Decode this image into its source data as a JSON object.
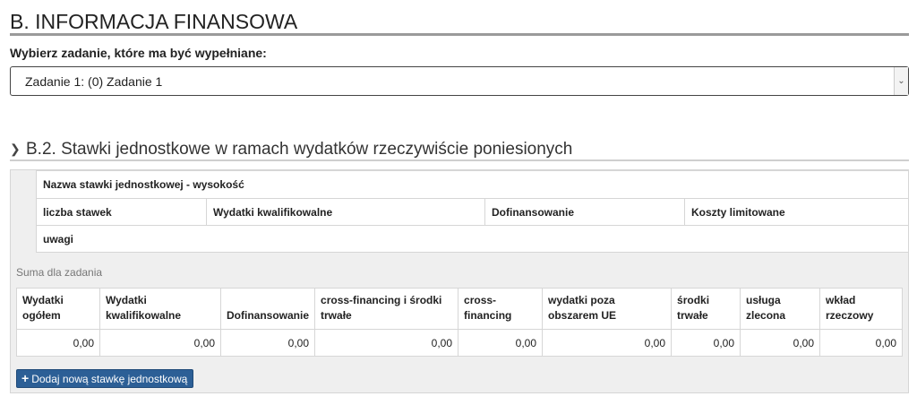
{
  "section": {
    "title": "B. INFORMACJA FINANSOWA"
  },
  "task_select": {
    "label": "Wybierz zadanie, które ma być wypełniane:",
    "value": "Zadanie 1: (0) Zadanie 1",
    "arrow_icon": "chevron-down-icon"
  },
  "subsection": {
    "title": "B.2. Stawki jednostkowe w ramach wydatków rzeczywiście poniesionych",
    "icon": "chevron-right-icon"
  },
  "unit_rates": {
    "name_header": "Nazwa stawki jednostkowej - wysokość",
    "columns": [
      "liczba stawek",
      "Wydatki kwalifikowalne",
      "Dofinansowanie",
      "Koszty limitowane"
    ],
    "remarks_header": "uwagi"
  },
  "task_sum": {
    "label": "Suma dla zadania",
    "headers": [
      "Wydatki ogółem",
      "Wydatki kwalifikowalne",
      "Dofinansowanie",
      "cross-financing i środki trwałe",
      "cross-financing",
      "wydatki poza obszarem UE",
      "środki trwałe",
      "usługa zlecona",
      "wkład rzeczowy"
    ],
    "values": [
      "0,00",
      "0,00",
      "0,00",
      "0,00",
      "0,00",
      "0,00",
      "0,00",
      "0,00",
      "0,00"
    ]
  },
  "add_button": {
    "label": "Dodaj nową stawkę jednostkową",
    "icon": "plus-icon"
  }
}
